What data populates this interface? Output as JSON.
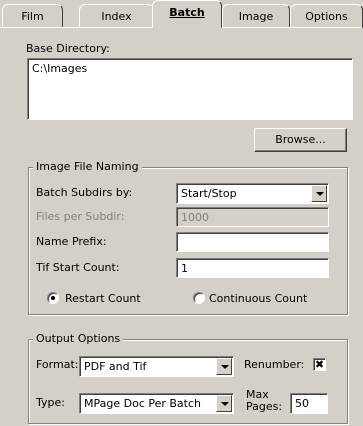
{
  "tabs": [
    {
      "label": "Film"
    },
    {
      "label": "Index"
    },
    {
      "label": "Batch"
    },
    {
      "label": "Image"
    },
    {
      "label": "Options"
    }
  ],
  "base_directory": {
    "label": "Base Directory:",
    "value": "C:\\Images",
    "browse_label": "Browse..."
  },
  "image_file_naming": {
    "legend": "Image File Naming",
    "batch_subdirs_label": "Batch Subdirs by:",
    "batch_subdirs_value": "Start/Stop",
    "files_per_subdir_label": "Files per Subdir:",
    "files_per_subdir_value": "1000",
    "name_prefix_label": "Name Prefix:",
    "name_prefix_value": "",
    "tif_start_count_label": "Tif Start Count:",
    "tif_start_count_value": "1",
    "restart_count_label": "Restart Count",
    "continuous_count_label": "Continuous Count",
    "selected_count_mode": "restart"
  },
  "output_options": {
    "legend": "Output Options",
    "format_label": "Format:",
    "format_value": "PDF and Tif",
    "renumber_label": "Renumber:",
    "renumber_checked": true,
    "check_glyph": "✖",
    "type_label": "Type:",
    "type_value": "MPage Doc Per Batch",
    "max_pages_label_1": "Max",
    "max_pages_label_2": "Pages:",
    "max_pages_value": "50"
  }
}
